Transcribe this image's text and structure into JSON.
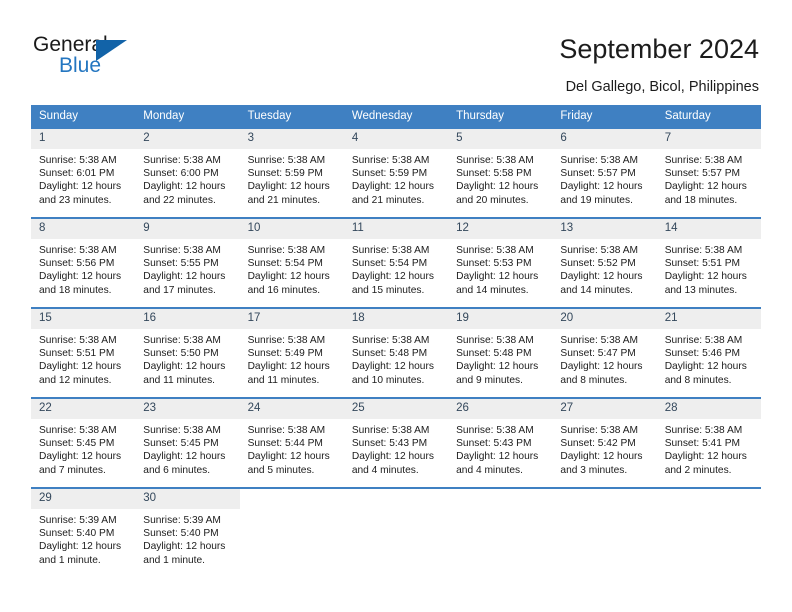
{
  "brand": {
    "name_part1": "General",
    "name_part2": "Blue",
    "accent_color": "#2476c0",
    "triangle_color": "#1263a8"
  },
  "header": {
    "title": "September 2024",
    "subtitle": "Del Gallego, Bicol, Philippines"
  },
  "calendar": {
    "header_bg": "#3f80c2",
    "daynum_bg": "#eeeeee",
    "weekdays": [
      "Sunday",
      "Monday",
      "Tuesday",
      "Wednesday",
      "Thursday",
      "Friday",
      "Saturday"
    ],
    "weeks": [
      [
        {
          "day": "1",
          "sunrise": "Sunrise: 5:38 AM",
          "sunset": "Sunset: 6:01 PM",
          "daylight_line1": "Daylight: 12 hours",
          "daylight_line2": "and 23 minutes."
        },
        {
          "day": "2",
          "sunrise": "Sunrise: 5:38 AM",
          "sunset": "Sunset: 6:00 PM",
          "daylight_line1": "Daylight: 12 hours",
          "daylight_line2": "and 22 minutes."
        },
        {
          "day": "3",
          "sunrise": "Sunrise: 5:38 AM",
          "sunset": "Sunset: 5:59 PM",
          "daylight_line1": "Daylight: 12 hours",
          "daylight_line2": "and 21 minutes."
        },
        {
          "day": "4",
          "sunrise": "Sunrise: 5:38 AM",
          "sunset": "Sunset: 5:59 PM",
          "daylight_line1": "Daylight: 12 hours",
          "daylight_line2": "and 21 minutes."
        },
        {
          "day": "5",
          "sunrise": "Sunrise: 5:38 AM",
          "sunset": "Sunset: 5:58 PM",
          "daylight_line1": "Daylight: 12 hours",
          "daylight_line2": "and 20 minutes."
        },
        {
          "day": "6",
          "sunrise": "Sunrise: 5:38 AM",
          "sunset": "Sunset: 5:57 PM",
          "daylight_line1": "Daylight: 12 hours",
          "daylight_line2": "and 19 minutes."
        },
        {
          "day": "7",
          "sunrise": "Sunrise: 5:38 AM",
          "sunset": "Sunset: 5:57 PM",
          "daylight_line1": "Daylight: 12 hours",
          "daylight_line2": "and 18 minutes."
        }
      ],
      [
        {
          "day": "8",
          "sunrise": "Sunrise: 5:38 AM",
          "sunset": "Sunset: 5:56 PM",
          "daylight_line1": "Daylight: 12 hours",
          "daylight_line2": "and 18 minutes."
        },
        {
          "day": "9",
          "sunrise": "Sunrise: 5:38 AM",
          "sunset": "Sunset: 5:55 PM",
          "daylight_line1": "Daylight: 12 hours",
          "daylight_line2": "and 17 minutes."
        },
        {
          "day": "10",
          "sunrise": "Sunrise: 5:38 AM",
          "sunset": "Sunset: 5:54 PM",
          "daylight_line1": "Daylight: 12 hours",
          "daylight_line2": "and 16 minutes."
        },
        {
          "day": "11",
          "sunrise": "Sunrise: 5:38 AM",
          "sunset": "Sunset: 5:54 PM",
          "daylight_line1": "Daylight: 12 hours",
          "daylight_line2": "and 15 minutes."
        },
        {
          "day": "12",
          "sunrise": "Sunrise: 5:38 AM",
          "sunset": "Sunset: 5:53 PM",
          "daylight_line1": "Daylight: 12 hours",
          "daylight_line2": "and 14 minutes."
        },
        {
          "day": "13",
          "sunrise": "Sunrise: 5:38 AM",
          "sunset": "Sunset: 5:52 PM",
          "daylight_line1": "Daylight: 12 hours",
          "daylight_line2": "and 14 minutes."
        },
        {
          "day": "14",
          "sunrise": "Sunrise: 5:38 AM",
          "sunset": "Sunset: 5:51 PM",
          "daylight_line1": "Daylight: 12 hours",
          "daylight_line2": "and 13 minutes."
        }
      ],
      [
        {
          "day": "15",
          "sunrise": "Sunrise: 5:38 AM",
          "sunset": "Sunset: 5:51 PM",
          "daylight_line1": "Daylight: 12 hours",
          "daylight_line2": "and 12 minutes."
        },
        {
          "day": "16",
          "sunrise": "Sunrise: 5:38 AM",
          "sunset": "Sunset: 5:50 PM",
          "daylight_line1": "Daylight: 12 hours",
          "daylight_line2": "and 11 minutes."
        },
        {
          "day": "17",
          "sunrise": "Sunrise: 5:38 AM",
          "sunset": "Sunset: 5:49 PM",
          "daylight_line1": "Daylight: 12 hours",
          "daylight_line2": "and 11 minutes."
        },
        {
          "day": "18",
          "sunrise": "Sunrise: 5:38 AM",
          "sunset": "Sunset: 5:48 PM",
          "daylight_line1": "Daylight: 12 hours",
          "daylight_line2": "and 10 minutes."
        },
        {
          "day": "19",
          "sunrise": "Sunrise: 5:38 AM",
          "sunset": "Sunset: 5:48 PM",
          "daylight_line1": "Daylight: 12 hours",
          "daylight_line2": "and 9 minutes."
        },
        {
          "day": "20",
          "sunrise": "Sunrise: 5:38 AM",
          "sunset": "Sunset: 5:47 PM",
          "daylight_line1": "Daylight: 12 hours",
          "daylight_line2": "and 8 minutes."
        },
        {
          "day": "21",
          "sunrise": "Sunrise: 5:38 AM",
          "sunset": "Sunset: 5:46 PM",
          "daylight_line1": "Daylight: 12 hours",
          "daylight_line2": "and 8 minutes."
        }
      ],
      [
        {
          "day": "22",
          "sunrise": "Sunrise: 5:38 AM",
          "sunset": "Sunset: 5:45 PM",
          "daylight_line1": "Daylight: 12 hours",
          "daylight_line2": "and 7 minutes."
        },
        {
          "day": "23",
          "sunrise": "Sunrise: 5:38 AM",
          "sunset": "Sunset: 5:45 PM",
          "daylight_line1": "Daylight: 12 hours",
          "daylight_line2": "and 6 minutes."
        },
        {
          "day": "24",
          "sunrise": "Sunrise: 5:38 AM",
          "sunset": "Sunset: 5:44 PM",
          "daylight_line1": "Daylight: 12 hours",
          "daylight_line2": "and 5 minutes."
        },
        {
          "day": "25",
          "sunrise": "Sunrise: 5:38 AM",
          "sunset": "Sunset: 5:43 PM",
          "daylight_line1": "Daylight: 12 hours",
          "daylight_line2": "and 4 minutes."
        },
        {
          "day": "26",
          "sunrise": "Sunrise: 5:38 AM",
          "sunset": "Sunset: 5:43 PM",
          "daylight_line1": "Daylight: 12 hours",
          "daylight_line2": "and 4 minutes."
        },
        {
          "day": "27",
          "sunrise": "Sunrise: 5:38 AM",
          "sunset": "Sunset: 5:42 PM",
          "daylight_line1": "Daylight: 12 hours",
          "daylight_line2": "and 3 minutes."
        },
        {
          "day": "28",
          "sunrise": "Sunrise: 5:38 AM",
          "sunset": "Sunset: 5:41 PM",
          "daylight_line1": "Daylight: 12 hours",
          "daylight_line2": "and 2 minutes."
        }
      ],
      [
        {
          "day": "29",
          "sunrise": "Sunrise: 5:39 AM",
          "sunset": "Sunset: 5:40 PM",
          "daylight_line1": "Daylight: 12 hours",
          "daylight_line2": "and 1 minute."
        },
        {
          "day": "30",
          "sunrise": "Sunrise: 5:39 AM",
          "sunset": "Sunset: 5:40 PM",
          "daylight_line1": "Daylight: 12 hours",
          "daylight_line2": "and 1 minute."
        },
        {
          "day": "",
          "sunrise": "",
          "sunset": "",
          "daylight_line1": "",
          "daylight_line2": ""
        },
        {
          "day": "",
          "sunrise": "",
          "sunset": "",
          "daylight_line1": "",
          "daylight_line2": ""
        },
        {
          "day": "",
          "sunrise": "",
          "sunset": "",
          "daylight_line1": "",
          "daylight_line2": ""
        },
        {
          "day": "",
          "sunrise": "",
          "sunset": "",
          "daylight_line1": "",
          "daylight_line2": ""
        },
        {
          "day": "",
          "sunrise": "",
          "sunset": "",
          "daylight_line1": "",
          "daylight_line2": ""
        }
      ]
    ]
  }
}
